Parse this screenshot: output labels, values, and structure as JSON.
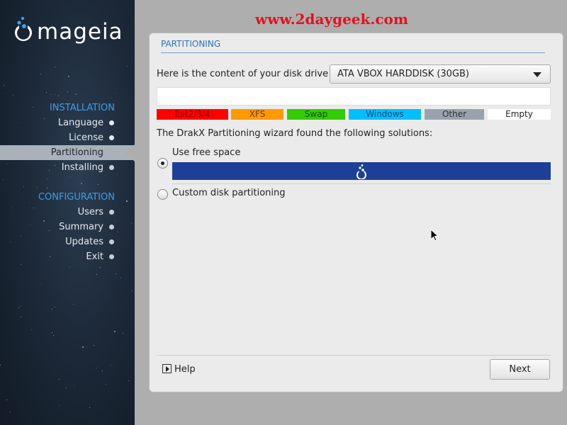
{
  "banner": {
    "text": "www.2daygeek.com",
    "color": "#e2121c"
  },
  "brand": {
    "logo_text": "mageia"
  },
  "sidebar": {
    "sections": [
      {
        "title": "INSTALLATION",
        "items": [
          {
            "label": "Language",
            "state": "done"
          },
          {
            "label": "License",
            "state": "done"
          },
          {
            "label": "Partitioning",
            "state": "active"
          },
          {
            "label": "Installing",
            "state": "pending"
          }
        ]
      },
      {
        "title": "CONFIGURATION",
        "items": [
          {
            "label": "Users",
            "state": "pending"
          },
          {
            "label": "Summary",
            "state": "pending"
          },
          {
            "label": "Updates",
            "state": "pending"
          },
          {
            "label": "Exit",
            "state": "pending"
          }
        ]
      }
    ],
    "accent_color": "#3a9ee8"
  },
  "panel": {
    "title": "PARTITIONING",
    "disk_prompt": "Here is the content of your disk drive",
    "disk_selected": "ATA VBOX HARDDISK (30GB)",
    "legend": [
      {
        "label": "Ext2/3/4",
        "color": "#ff0000",
        "text_color": "#8a0000"
      },
      {
        "label": "XFS",
        "color": "#ff9900",
        "text_color": "#6a3a00"
      },
      {
        "label": "Swap",
        "color": "#33cc00",
        "text_color": "#144d00"
      },
      {
        "label": "Windows",
        "color": "#00bfff",
        "text_color": "#004a70"
      },
      {
        "label": "Other",
        "color": "#9aa3ad",
        "text_color": "#2a3038"
      },
      {
        "label": "Empty",
        "color": "#ffffff",
        "text_color": "#222222"
      }
    ],
    "solutions_prompt": "The DrakX Partitioning wizard found the following solutions:",
    "options": [
      {
        "label": "Use free space",
        "selected": true,
        "bar_color": "#1e3f98"
      },
      {
        "label": "Custom disk partitioning",
        "selected": false
      }
    ],
    "help_label": "Help",
    "next_label": "Next"
  }
}
